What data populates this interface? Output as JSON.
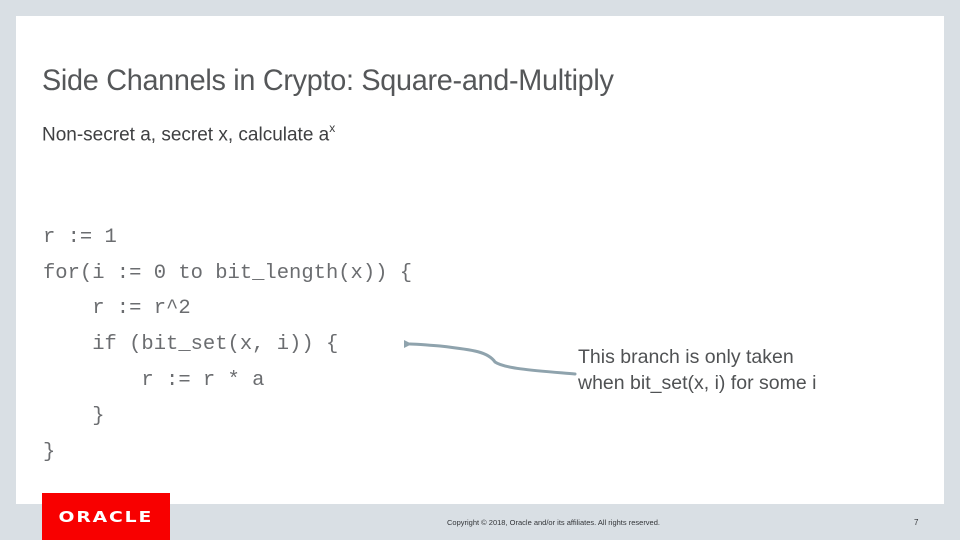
{
  "slide": {
    "title": "Side Channels in Crypto: Square-and-Multiply",
    "subtitle": {
      "text": "Non-secret a, secret x, calculate a",
      "superscript": "x"
    },
    "code_lines": [
      "r := 1",
      "for(i := 0 to bit_length(x)) {",
      "    r := r^2",
      "    if (bit_set(x, i)) {",
      "        r := r * a",
      "    }",
      "}"
    ],
    "callout": {
      "line1": "This branch is only taken",
      "line2": "when bit_set(x, i) for some i"
    },
    "arrow_color": "#8fa3ad"
  },
  "footer": {
    "logo_text": "ORACLE",
    "logo_color": "#f80000",
    "copyright": "Copyright © 2018, Oracle and/or its affiliates. All rights reserved.",
    "page_number": "7"
  }
}
